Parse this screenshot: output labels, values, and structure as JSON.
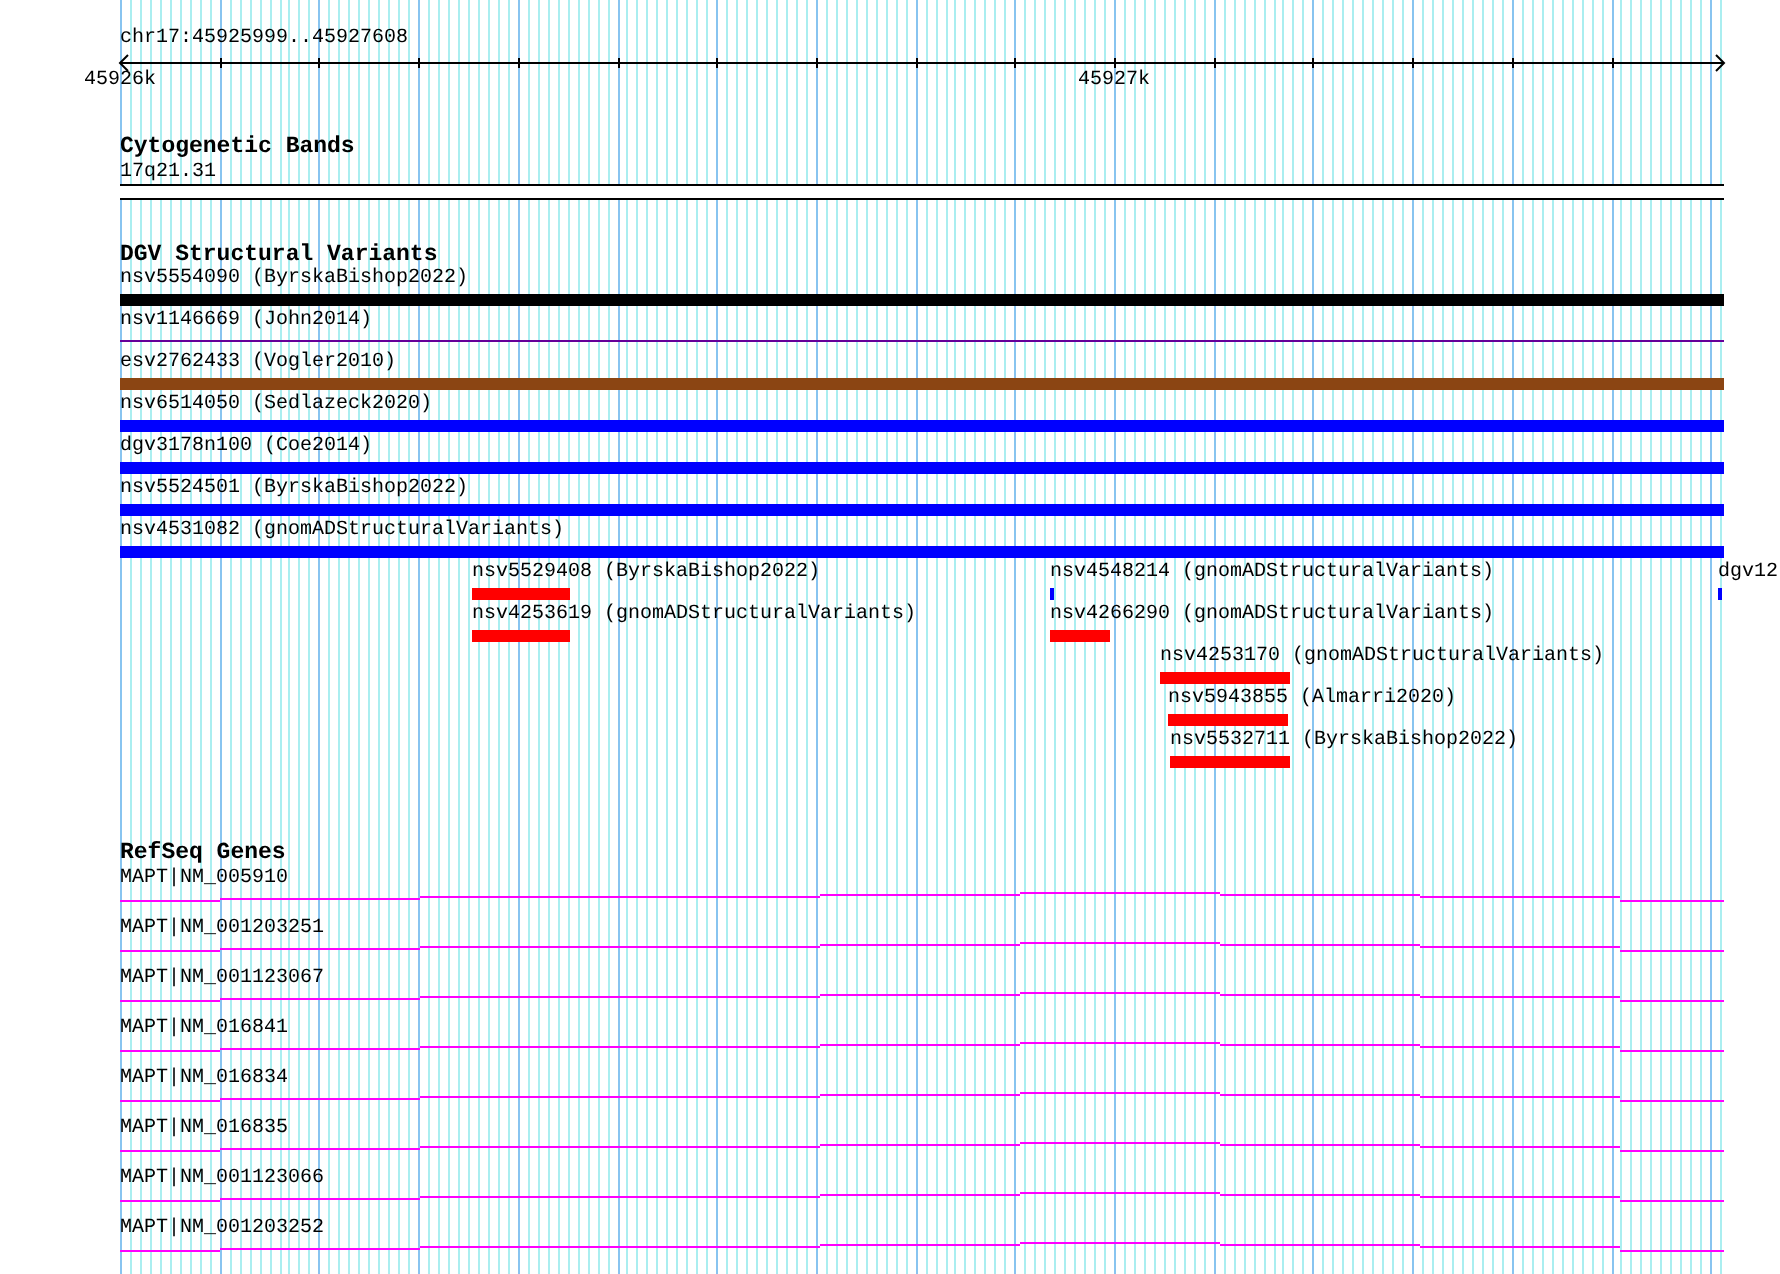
{
  "ruler": {
    "location": "chr17:45925999..45927608",
    "ticks": [
      "45926k",
      "45927k"
    ]
  },
  "cytogenetic_bands": {
    "title": "Cytogenetic Bands",
    "band": "17q21.31"
  },
  "dgv_structural_variants": {
    "title": "DGV Structural Variants",
    "variants": [
      {
        "label": "nsv5554090 (ByrskaBishop2022)",
        "color": "#000000",
        "kind": "thick"
      },
      {
        "label": "nsv1146669 (John2014)",
        "color": "#660099",
        "kind": "thin"
      },
      {
        "label": "esv2762433 (Vogler2010)",
        "color": "#8b4513",
        "kind": "thick"
      },
      {
        "label": "nsv6514050 (Sedlazeck2020)",
        "color": "#0000ff",
        "kind": "thick"
      },
      {
        "label": "dgv3178n100 (Coe2014)",
        "color": "#0000ff",
        "kind": "thick"
      },
      {
        "label": "nsv5524501 (ByrskaBishop2022)",
        "color": "#0000ff",
        "kind": "thick"
      },
      {
        "label": "nsv4531082 (gnomADStructuralVariants)",
        "color": "#0000ff",
        "kind": "thick"
      },
      {
        "label": "nsv5529408 (ByrskaBishop2022)",
        "color": "#ff0000",
        "kind": "thick"
      },
      {
        "label": "nsv4548214 (gnomADStructuralVariants)",
        "color": "#0000ff",
        "kind": "thick"
      },
      {
        "label": "dgv12",
        "color": "#0000ff",
        "kind": "thick"
      },
      {
        "label": "nsv4253619 (gnomADStructuralVariants)",
        "color": "#ff0000",
        "kind": "thick"
      },
      {
        "label": "nsv4266290 (gnomADStructuralVariants)",
        "color": "#ff0000",
        "kind": "thick"
      },
      {
        "label": "nsv4253170 (gnomADStructuralVariants)",
        "color": "#ff0000",
        "kind": "thick"
      },
      {
        "label": "nsv5943855 (Almarri2020)",
        "color": "#ff0000",
        "kind": "thick"
      },
      {
        "label": "nsv5532711 (ByrskaBishop2022)",
        "color": "#ff0000",
        "kind": "thick"
      }
    ]
  },
  "refseq_genes": {
    "title": "RefSeq Genes",
    "transcripts": [
      {
        "label": "MAPT|NM_005910"
      },
      {
        "label": "MAPT|NM_001203251"
      },
      {
        "label": "MAPT|NM_001123067"
      },
      {
        "label": "MAPT|NM_016841"
      },
      {
        "label": "MAPT|NM_016834"
      },
      {
        "label": "MAPT|NM_016835"
      },
      {
        "label": "MAPT|NM_001123066"
      },
      {
        "label": "MAPT|NM_001203252"
      }
    ]
  }
}
